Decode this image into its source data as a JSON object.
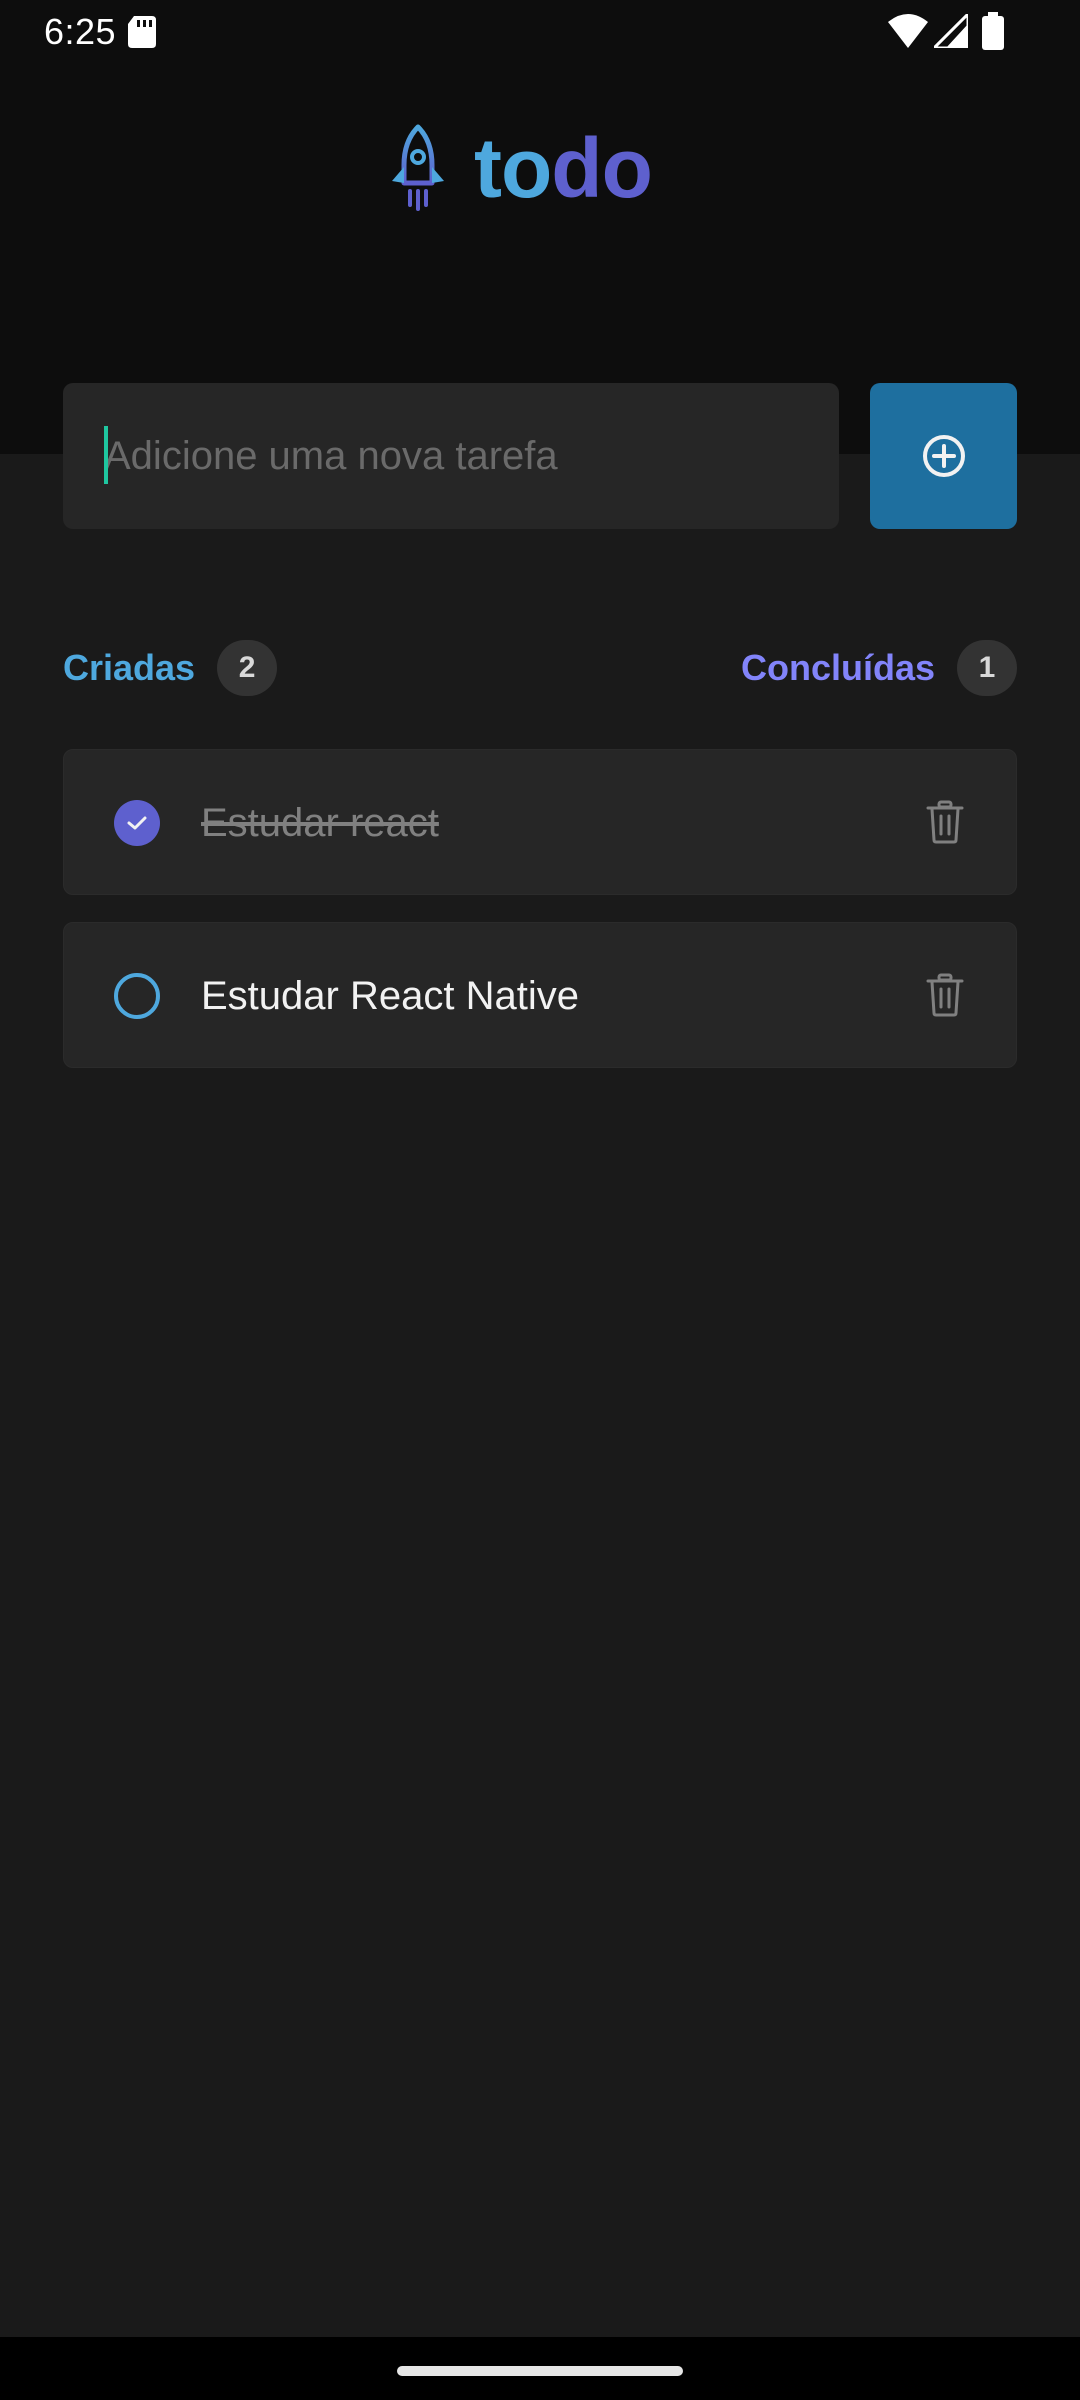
{
  "status_bar": {
    "time": "6:25",
    "icons": [
      "sd-card-icon",
      "wifi-icon",
      "signal-icon",
      "battery-icon"
    ]
  },
  "logo": {
    "icon": "rocket-icon",
    "text_part1": "to",
    "text_part2": "do"
  },
  "input": {
    "value": "",
    "placeholder": "Adicione uma nova tarefa"
  },
  "add_button": {
    "icon": "plus-circle-icon"
  },
  "counters": {
    "created_label": "Criadas",
    "created_count": "2",
    "done_label": "Concluídas",
    "done_count": "1"
  },
  "tasks": [
    {
      "text": "Estudar react",
      "done": true
    },
    {
      "text": "Estudar React Native",
      "done": false
    }
  ],
  "colors": {
    "blue": "#4ea8de",
    "blue_dark": "#1e6f9f",
    "purple": "#5e60ce",
    "purple_light": "#8284fa",
    "background": "#1a1a1a",
    "header": "#0d0d0d",
    "card": "#262626"
  }
}
